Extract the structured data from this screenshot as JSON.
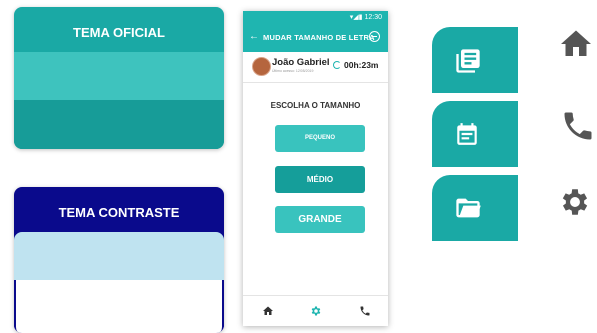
{
  "themes": {
    "official": {
      "title": "TEMA OFICIAL"
    },
    "contrast": {
      "title": "TEMA CONTRASTE"
    }
  },
  "phone": {
    "status_time": "12:30",
    "appbar_title": "MUDAR TAMANHO DE LETRA",
    "user_name": "João Gabriel",
    "user_sub": "Último acesso: 12/05/2019",
    "timer": "00h:23m",
    "section_title": "ESCOLHA O TAMANHO",
    "sizes": [
      "PEQUENO",
      "MÉDIO",
      "GRANDE"
    ],
    "bottom_nav": [
      "home-icon",
      "gear-icon",
      "phone-icon"
    ]
  },
  "side_tabs": [
    "document-icon",
    "calendar-icon",
    "folder-icon"
  ],
  "side_icons": [
    "home-icon",
    "phone-icon",
    "gear-icon"
  ],
  "colors": {
    "teal": "#1fb5b0",
    "teal_dark": "#159e9a",
    "teal_light": "#39c3be",
    "navy": "#0a0a8c",
    "light_blue": "#bfe3f0",
    "icon_gray": "#555555"
  }
}
